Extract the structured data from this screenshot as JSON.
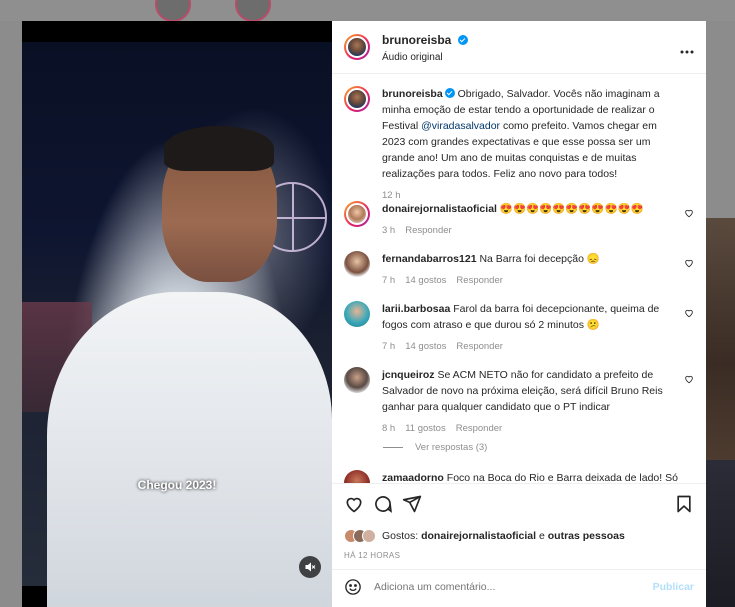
{
  "post": {
    "author": "brunoreisba",
    "audio": "Áudio original",
    "more_icon": "more-horizontal-icon",
    "video_caption": "Chegou 2023!",
    "caption_before_mention": "Obrigado, Salvador. Vocês não imaginam a minha emoção de estar tendo a oportunidade de realizar o Festival ",
    "caption_mention": "@viradasalvador",
    "caption_after_mention": " como prefeito. Vamos chegar em 2023 com grandes expectativas e que esse possa ser um grande ano! Um ano de muitas conquistas e de muitas realizações para todos. Feliz ano novo para todos!",
    "caption_time": "12 h"
  },
  "comments": [
    {
      "user": "donairejornalistaoficial",
      "text": "😍😍😍😍😍😍😍😍😍😍😍",
      "time": "3 h",
      "likes": "",
      "reply": "Responder"
    },
    {
      "user": "fernandabarros121",
      "text": "Na Barra foi decepção 😞",
      "time": "7 h",
      "likes": "14 gostos",
      "reply": "Responder"
    },
    {
      "user": "larii.barbosaa",
      "text": "Farol da barra foi decepcionante, queima de fogos com atraso e que durou só 2 minutos 😕",
      "time": "7 h",
      "likes": "14 gostos",
      "reply": "Responder"
    },
    {
      "user": "jcnqueiroz",
      "text": "Se ACM NETO não for candidato a prefeito de Salvador de novo na próxima eleição, será difícil Bruno Reis ganhar para qualquer candidato que o PT indicar",
      "time": "8 h",
      "likes": "11 gostos",
      "reply": "Responder",
      "view_replies": "Ver respostas (3)"
    },
    {
      "user": "zamaadorno",
      "text": "Foco na Boca do Rio e Barra deixada de lado! Só"
    }
  ],
  "likes": {
    "label": "Gostos:",
    "by_user": "donairejornalistaoficial",
    "connector": "e",
    "others": "outras pessoas"
  },
  "time_ago": "HÁ 12 HORAS",
  "add_comment": {
    "placeholder": "Adiciona um comentário...",
    "publish_label": "Publicar"
  },
  "colors": {
    "verified": "#0095f6",
    "link": "#00376b",
    "publish_disabled": "#b2dffc",
    "meta_text": "#8e8e8e"
  }
}
